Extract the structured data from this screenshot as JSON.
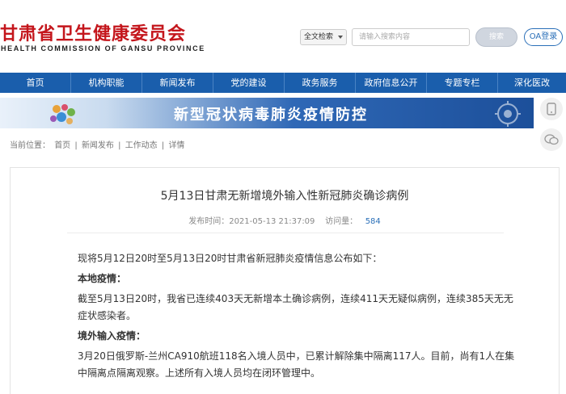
{
  "header": {
    "logo_cn": "甘肃省卫生健康委员会",
    "logo_en": "HEALTH COMMISSION OF GANSU PROVINCE",
    "search_scope": "全文检索",
    "search_placeholder": "请输入搜索内容",
    "search_button": "搜索",
    "oa_button": "OA登录"
  },
  "nav": {
    "items": [
      "首页",
      "机构职能",
      "新闻发布",
      "党的建设",
      "政务服务",
      "政府信息公开",
      "专题专栏",
      "深化医改"
    ]
  },
  "banner": {
    "text": "新型冠状病毒肺炎疫情防控"
  },
  "breadcrumb": {
    "prefix": "当前位置：",
    "items": [
      "首页",
      "新闻发布",
      "工作动态",
      "详情"
    ],
    "separator": "|"
  },
  "article": {
    "title": "5月13日甘肃无新增境外输入性新冠肺炎确诊病例",
    "publish_label": "发布时间：",
    "publish_time": "2021-05-13 21:37:09",
    "views_label": "访问量：",
    "views": "584",
    "intro": "现将5月12日20时至5月13日20时甘肃省新冠肺炎疫情信息公布如下：",
    "local_heading": "本地疫情：",
    "local_text": "截至5月13日20时，我省已连续403天无新增本土确诊病例，连续411天无疑似病例，连续385天无无症状感染者。",
    "imported_heading": "境外输入疫情：",
    "imported_text": "3月20日俄罗斯-兰州CA910航班118名入境人员中，已累计解除集中隔离117人。目前，尚有1人在集中隔离点隔离观察。上述所有入境人员均在闭环管理中。"
  },
  "colors": {
    "brand_red": "#c4161c",
    "nav_blue": "#1a5eac",
    "link_blue": "#2a6fb8"
  }
}
